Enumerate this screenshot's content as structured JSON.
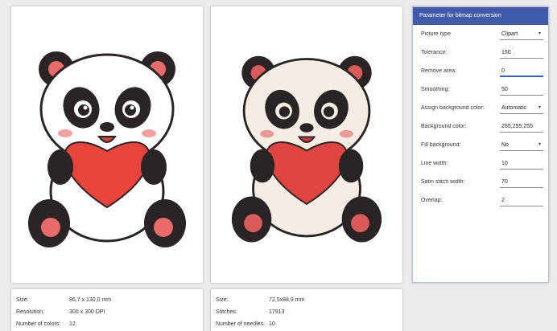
{
  "params": {
    "title": "Parameter for bitmap conversion",
    "rows": [
      {
        "label": "Picture type",
        "value": "Clipart",
        "dropdown": true
      },
      {
        "label": "Tolerance:",
        "value": "150",
        "dropdown": false
      },
      {
        "label": "Remove area:",
        "value": "0",
        "dropdown": false,
        "active": true
      },
      {
        "label": "Smoothing:",
        "value": "50",
        "dropdown": false
      },
      {
        "label": "Assign background color:",
        "value": "Automatic",
        "dropdown": true
      },
      {
        "label": "Background color:",
        "value": "255,255,255",
        "dropdown": false
      },
      {
        "label": "Fill background:",
        "value": "No",
        "dropdown": true
      },
      {
        "label": "Line width:",
        "value": "10",
        "dropdown": false
      },
      {
        "label": "Satin stitch width:",
        "value": "70",
        "dropdown": false
      },
      {
        "label": "Overlap:",
        "value": "2",
        "dropdown": false
      }
    ]
  },
  "info_left": {
    "rows": [
      {
        "label": "Size:",
        "value": "86,7 x 130,0 mm"
      },
      {
        "label": "Resolution:",
        "value": "300 x 300 DPI"
      },
      {
        "label": "Number of colors:",
        "value": "12"
      }
    ]
  },
  "info_right": {
    "rows": [
      {
        "label": "Size:",
        "value": "72,5x88,9 mm"
      },
      {
        "label": "Stitches:",
        "value": "17913"
      },
      {
        "label": "Number of needles:",
        "value": "10"
      }
    ]
  },
  "colors": {
    "title_bar": "#3f5baa",
    "active_field": "#2d64c8",
    "heart": "#e8433d",
    "panda_black": "#2a2424",
    "ear_pink": "#e86a6a"
  },
  "images": {
    "left": "panda-heart-original",
    "right": "panda-heart-embroidery-preview"
  }
}
